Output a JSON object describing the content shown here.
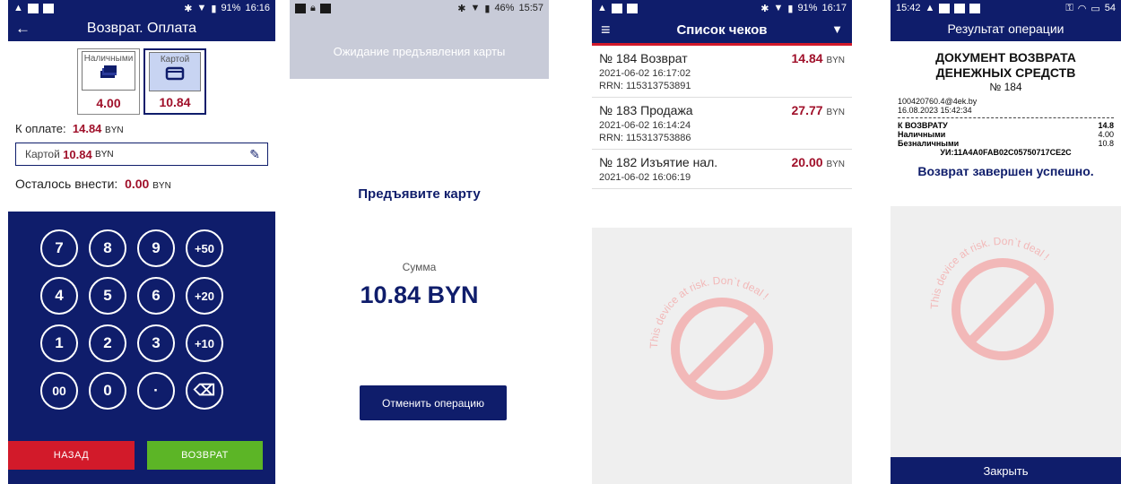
{
  "phone1": {
    "status_time": "16:16",
    "battery": "91%",
    "title": "Возврат. Оплата",
    "cash_label": "Наличными",
    "cash_amount": "4.00",
    "card_label": "Картой",
    "card_amount": "10.84",
    "to_pay_label": "К оплате:",
    "to_pay_value": "14.84",
    "currency": "BYN",
    "card_field_label": "Картой",
    "card_field_value": "10.84",
    "remaining_label": "Осталось внести:",
    "remaining_value": "0.00",
    "keys": [
      "7",
      "8",
      "9",
      "+50",
      "4",
      "5",
      "6",
      "+20",
      "1",
      "2",
      "3",
      "+10",
      "00",
      "0",
      "·",
      "⌫"
    ],
    "back_label": "НАЗАД",
    "refund_label": "ВОЗВРАТ"
  },
  "phone2": {
    "status_time": "15:57",
    "battery": "46%",
    "waiting_text": "Ожидание предъявления карты",
    "present_text": "Предъявите карту",
    "sum_label": "Сумма",
    "sum_value": "10.84 BYN",
    "cancel_label": "Отменить операцию"
  },
  "phone3": {
    "status_time": "16:17",
    "battery": "91%",
    "title": "Список чеков",
    "receipts": [
      {
        "title": "№ 184 Возврат",
        "amount": "14.84",
        "currency": "BYN",
        "date": "2021-06-02 16:17:02",
        "rrn": "RRN: 115313753891"
      },
      {
        "title": "№ 183 Продажа",
        "amount": "27.77",
        "currency": "BYN",
        "date": "2021-06-02 16:14:24",
        "rrn": "RRN: 115313753886"
      },
      {
        "title": "№ 182 Изъятие нал.",
        "amount": "20.00",
        "currency": "BYN",
        "date": "2021-06-02 16:06:19",
        "rrn": ""
      }
    ],
    "watermark": "This device at risk. Don`t deal !"
  },
  "phone4": {
    "status_time": "15:42",
    "battery": "54",
    "title": "Результат операции",
    "doc_title_1": "ДОКУМЕНТ ВОЗВРАТА",
    "doc_title_2": "ДЕНЕЖНЫХ СРЕДСТВ",
    "doc_no": "№ 184",
    "email": "100420760.4@4ek.by",
    "datetime": "16.08.2023 15:42:34",
    "to_refund_label": "К ВОЗВРАТУ",
    "to_refund_value": "14.8",
    "cash_label": "Наличными",
    "cash_value": "4.00",
    "noncash_label": "Безналичными",
    "noncash_value": "10.8",
    "ui_line": "УИ:11A4A0FAB02C05750717CE2C",
    "success_text": "Возврат завершен успешно.",
    "close_label": "Закрыть",
    "watermark": "This device at risk. Don`t deal !"
  }
}
